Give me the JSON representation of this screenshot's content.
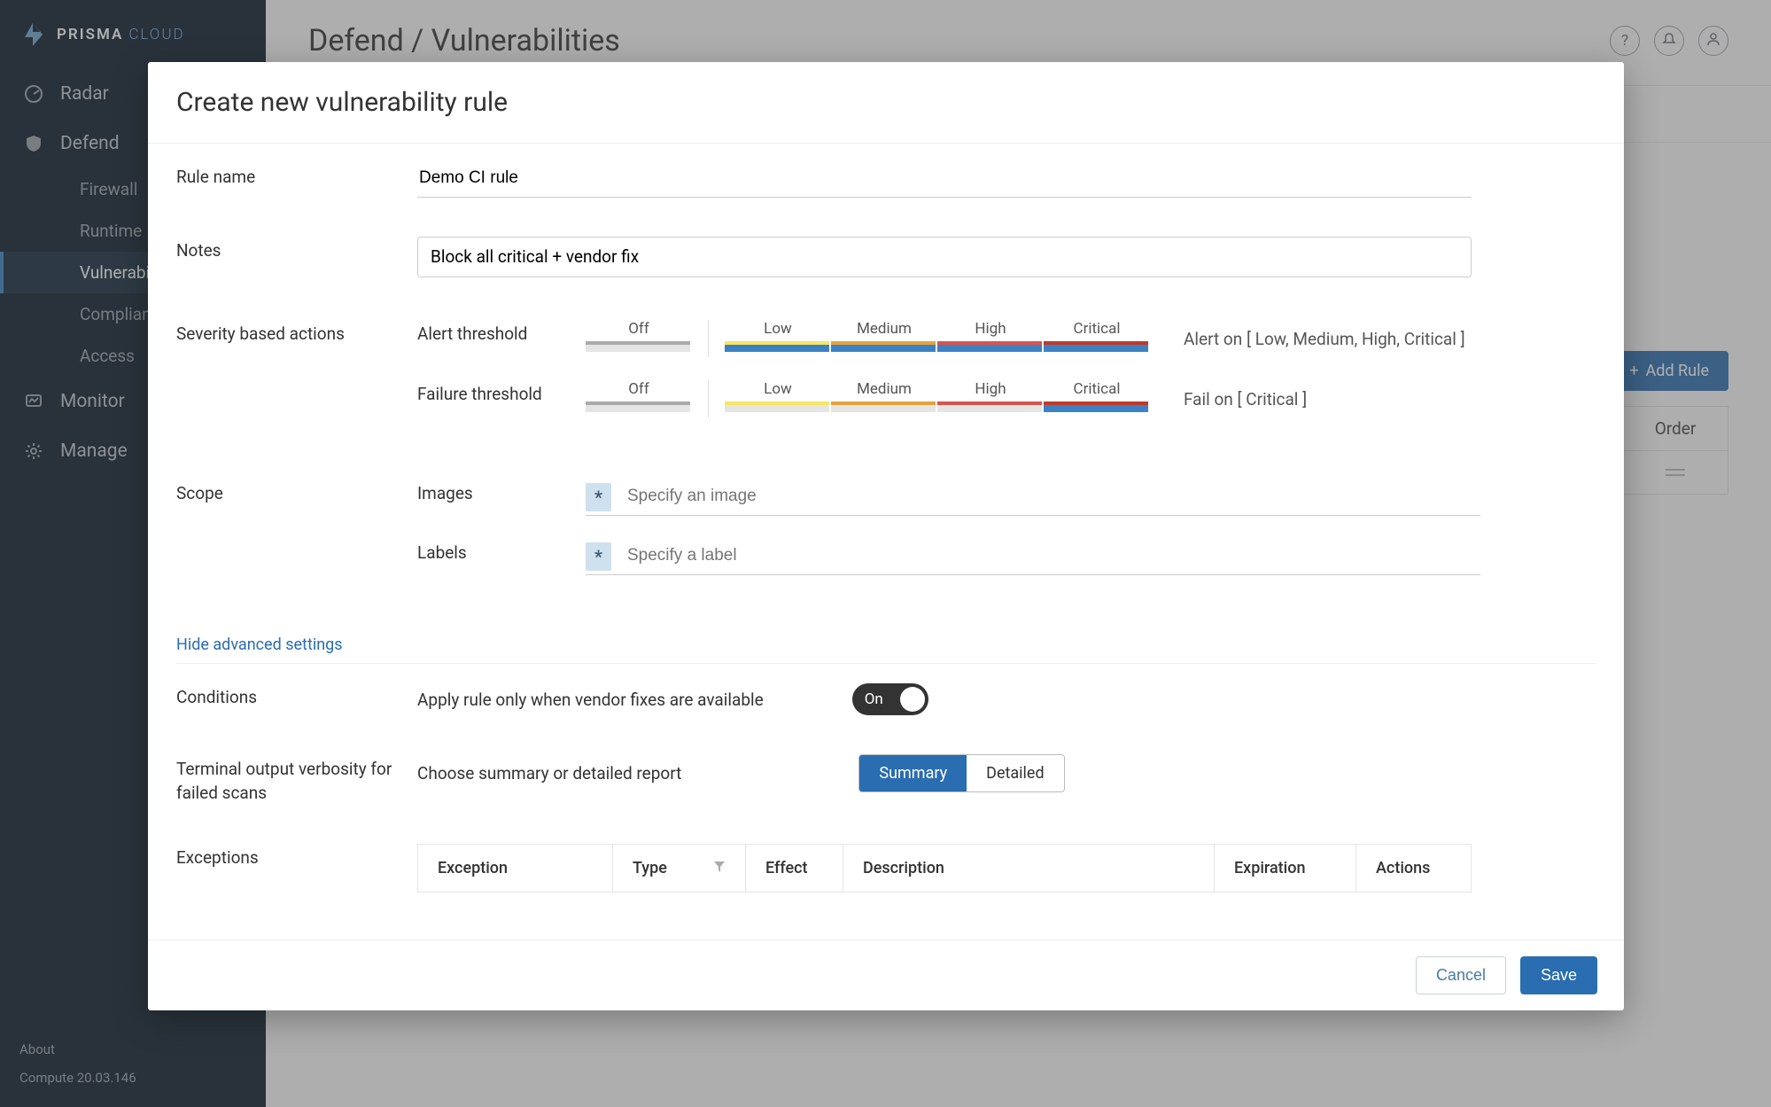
{
  "brand": {
    "name": "PRISMA",
    "sub": "CLOUD"
  },
  "sidebar": {
    "main": [
      {
        "label": "Radar"
      },
      {
        "label": "Defend"
      },
      {
        "label": "Monitor"
      },
      {
        "label": "Manage"
      }
    ],
    "defend_sub": [
      {
        "label": "Firewall"
      },
      {
        "label": "Runtime"
      },
      {
        "label": "Vulnerabilities"
      },
      {
        "label": "Compliance"
      },
      {
        "label": "Access"
      }
    ],
    "about": "About",
    "version": "Compute 20.03.146"
  },
  "page": {
    "title": "Defend / Vulnerabilities",
    "add_rule": "Add Rule",
    "order": "Order"
  },
  "modal": {
    "title": "Create new vulnerability rule",
    "rule_name_label": "Rule name",
    "rule_name_value": "Demo CI rule",
    "notes_label": "Notes",
    "notes_value": "Block all critical + vendor fix",
    "sev_label": "Severity based actions",
    "alert_label": "Alert threshold",
    "failure_label": "Failure threshold",
    "sev_levels": {
      "off": "Off",
      "low": "Low",
      "med": "Medium",
      "high": "High",
      "crit": "Critical"
    },
    "alert_summary": "Alert on [ Low, Medium, High, Critical ]",
    "fail_summary": "Fail on [ Critical ]",
    "scope_label": "Scope",
    "images_label": "Images",
    "labels_label": "Labels",
    "images_placeholder": "Specify an image",
    "labels_placeholder": "Specify a label",
    "wildcard": "*",
    "adv_link": "Hide advanced settings",
    "cond_label": "Conditions",
    "cond_desc": "Apply rule only when vendor fixes are available",
    "toggle_on": "On",
    "verbosity_label": "Terminal output verbosity for failed scans",
    "verbosity_desc": "Choose summary or detailed report",
    "pill_summary": "Summary",
    "pill_detailed": "Detailed",
    "exc_label": "Exceptions",
    "exc_cols": {
      "exception": "Exception",
      "type": "Type",
      "effect": "Effect",
      "description": "Description",
      "expiration": "Expiration",
      "actions": "Actions"
    },
    "cancel": "Cancel",
    "save": "Save"
  }
}
